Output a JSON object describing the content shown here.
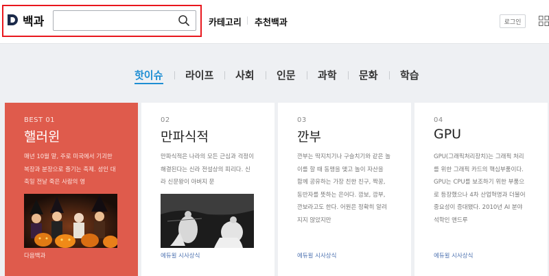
{
  "header": {
    "brand": "백과",
    "search": {
      "value": "",
      "placeholder": ""
    },
    "nav": [
      "카테고리",
      "추천백과"
    ],
    "login_label": "로그인"
  },
  "tabs": {
    "items": [
      "핫이슈",
      "라이프",
      "사회",
      "인문",
      "과학",
      "문화",
      "학습"
    ],
    "active_index": 0
  },
  "cards": [
    {
      "num": "BEST 01",
      "title": "핼러윈",
      "desc": "매년 10월 말, 주로 미국에서 기괴한 복장과 분장으로 즐기는 축제. 성인 대축일 전날 죽은 사람의 영",
      "source": "다음백과"
    },
    {
      "num": "02",
      "title": "만파식적",
      "desc": "만파식적은 나라의 모든 근심과 걱정이 해결된다는 신라 전설상의 피리다. 신라 신문왕이 아버지 문",
      "source": "에듀윌 시사상식"
    },
    {
      "num": "03",
      "title": "깐부",
      "desc": "깐부는 딱지치기나 구슬치기와 같은 놀이를 할 때 동맹을 맺고 놀이 자산을 함께 공유하는 가장 친한 친구, 짝꿍, 동반자를 뜻하는 은어다. 깜보, 깜부, 깐보라고도 한다. 어원은 정확히 알려지지 않았지만",
      "source": "에듀윌 시사상식"
    },
    {
      "num": "04",
      "title": "GPU",
      "desc": "GPU(그래픽처리장치)는 그래픽 처리를 위한 그래픽 카드의 핵심부품이다. GPU는 CPU를 보조하기 위한 부품으로 등장했으나 4차 산업혁명과 더불어 중요성이 증대됐다. 2010년 AI 분야 석학인 앤드루",
      "source": "에듀윌 시사상식"
    }
  ],
  "colors": {
    "accent": "#1c8dd3",
    "featured_card": "#df5b4c",
    "highlight_border": "#e8161c",
    "source_link": "#4d72b0"
  }
}
